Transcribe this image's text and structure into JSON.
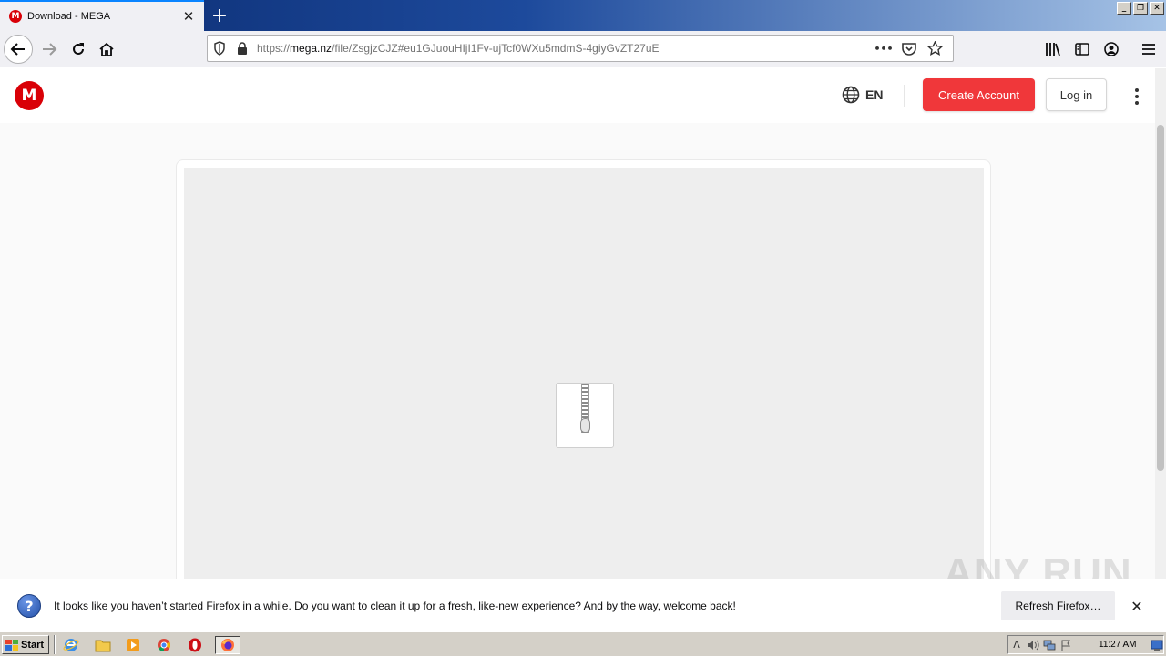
{
  "browser": {
    "tab": {
      "title": "Download - MEGA",
      "favicon_letter": "M",
      "close_glyph": "✕"
    },
    "new_tab_glyph": "+",
    "window_buttons": [
      "_",
      "❐",
      "✕"
    ],
    "address_bar": {
      "url_prefix": "https://",
      "url_host": "mega.nz",
      "url_path": "/file/ZsgjzCJZ#eu1GJuouHIjI1Fv-ujTcf0WXu5mdmS-4giyGvZT27uE",
      "more_glyph": "•••"
    }
  },
  "mega": {
    "logo_letter": "M",
    "language": "EN",
    "create_account_label": "Create Account",
    "login_label": "Log in"
  },
  "notification": {
    "icon_glyph": "?",
    "message": "It looks like you haven’t started Firefox in a while. Do you want to clean it up for a fresh, like-new experience? And by the way, welcome back!",
    "refresh_label": "Refresh Firefox…",
    "close_glyph": "✕"
  },
  "watermark": "ANY RUN",
  "taskbar": {
    "start_label": "Start",
    "clock": "11:27 AM",
    "tray_expand_glyph": "ᐱ"
  },
  "colors": {
    "mega_red": "#d90007",
    "create_button": "#f0373a",
    "firefox_accent": "#0a84ff"
  }
}
